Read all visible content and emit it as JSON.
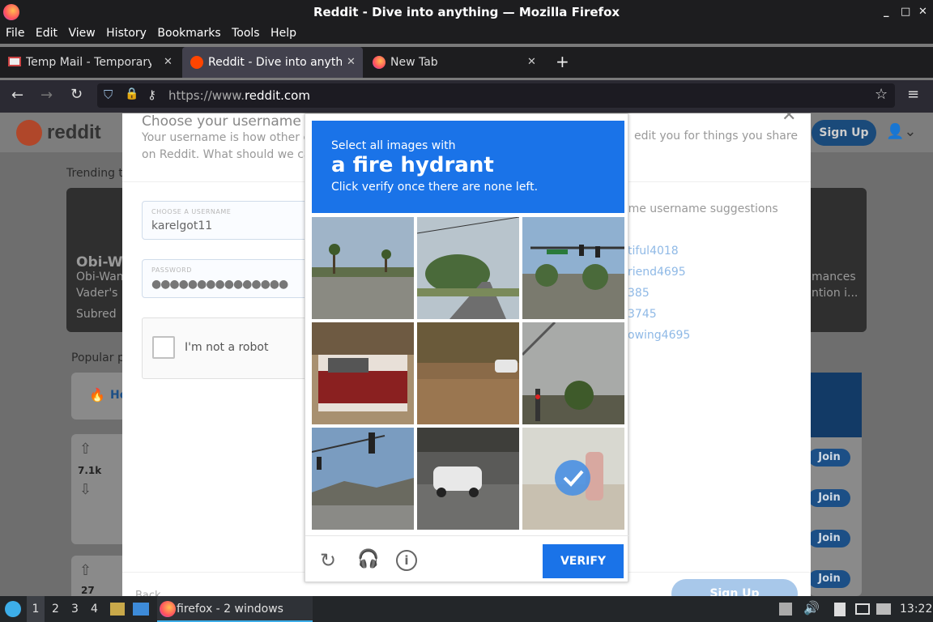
{
  "window": {
    "title": "Reddit - Dive into anything — Mozilla Firefox",
    "controls": [
      "_",
      "□",
      "✕"
    ]
  },
  "menu": [
    "File",
    "Edit",
    "View",
    "History",
    "Bookmarks",
    "Tools",
    "Help"
  ],
  "tabs": [
    {
      "label": "Temp Mail - Temporary Em",
      "icon": "mail-icon"
    },
    {
      "label": "Reddit - Dive into anythin",
      "icon": "reddit-icon",
      "active": true
    },
    {
      "label": "New Tab",
      "icon": "firefox-icon"
    }
  ],
  "url": {
    "prefix": "https://www.",
    "domain": "reddit.com"
  },
  "reddit": {
    "logo_text": "reddit",
    "signup": "Sign Up",
    "trending": "Trending to",
    "card_title": "Obi-Wa",
    "card_sub1": "Obi-Wan",
    "card_sub2": "Vader's li",
    "card_right1": "mances",
    "card_right2": "ntion i...",
    "subreddit_label": "Subred",
    "popular": "Popular p",
    "home_label": "Ho",
    "vote_count1": "7.1k",
    "vote_count2": "27",
    "join": "Join"
  },
  "modal": {
    "title": "Choose your username",
    "subtitle_left": "Your username is how other co",
    "subtitle_left2": "on Reddit. What should we call",
    "subtitle_right": "edit you for things you share",
    "username_label": "CHOOSE A USERNAME",
    "username_value": "karelgot11",
    "password_label": "PASSWORD",
    "password_value": "●●●●●●●●●●●●●●●",
    "robot_label": "I'm not a robot",
    "suggest_heading": "ome username suggestions",
    "suggestions": [
      "tiful4018",
      "riend4695",
      "385",
      "3745",
      "owing4695"
    ],
    "back": "Back",
    "signup": "Sign Up"
  },
  "captcha": {
    "line1": "Select all images with",
    "line2": "a fire hydrant",
    "line3": "Click verify once there are none left.",
    "verify": "VERIFY"
  },
  "taskbar": {
    "workspaces": [
      "1",
      "2",
      "3",
      "4"
    ],
    "firefox_label": "firefox - 2 windows",
    "clock": "13:22"
  },
  "colors": {
    "accent": "#1a73e8",
    "reddit": "#ff4500"
  }
}
